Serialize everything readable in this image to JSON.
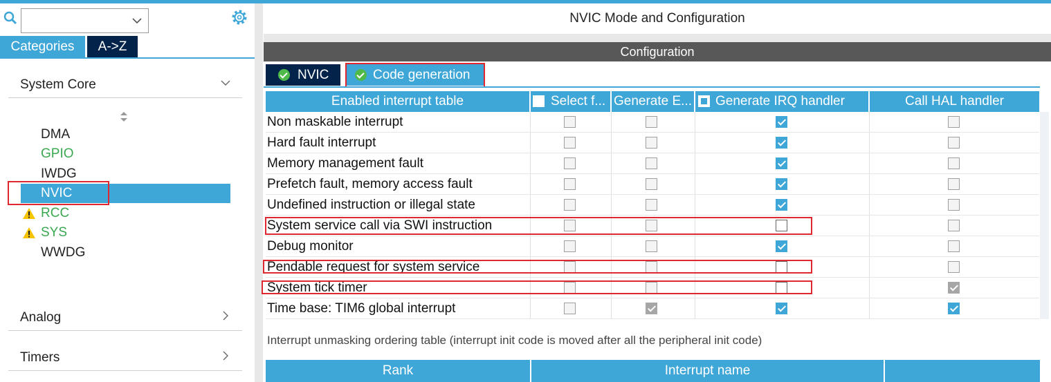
{
  "left": {
    "categories_tab": "Categories",
    "az_tab": "A->Z",
    "system_core": "System Core",
    "analog": "Analog",
    "timers": "Timers",
    "peripherals": [
      {
        "label": "DMA",
        "state": "normal"
      },
      {
        "label": "GPIO",
        "state": "green"
      },
      {
        "label": "IWDG",
        "state": "normal"
      },
      {
        "label": "NVIC",
        "state": "selected"
      },
      {
        "label": "RCC",
        "state": "warning"
      },
      {
        "label": "SYS",
        "state": "warning"
      },
      {
        "label": "WWDG",
        "state": "normal"
      }
    ]
  },
  "right": {
    "title": "NVIC Mode and Configuration",
    "config_bar": "Configuration",
    "tabs": [
      "NVIC",
      "Code generation"
    ],
    "headers": {
      "name": "Enabled interrupt table",
      "select": "Select f...",
      "generate_enable": "Generate E...",
      "generate_irq": "Generate IRQ handler",
      "call_hal": "Call HAL handler"
    },
    "rows": [
      {
        "name": "Non maskable interrupt",
        "select": "off",
        "gen_enable": "off",
        "gen_irq": "on",
        "call_hal": "off"
      },
      {
        "name": "Hard fault interrupt",
        "select": "off",
        "gen_enable": "off",
        "gen_irq": "on",
        "call_hal": "off"
      },
      {
        "name": "Memory management fault",
        "select": "off",
        "gen_enable": "off",
        "gen_irq": "on",
        "call_hal": "off"
      },
      {
        "name": "Prefetch fault, memory access fault",
        "select": "off",
        "gen_enable": "off",
        "gen_irq": "on",
        "call_hal": "off"
      },
      {
        "name": "Undefined instruction or illegal state",
        "select": "off",
        "gen_enable": "off",
        "gen_irq": "on",
        "call_hal": "off"
      },
      {
        "name": "System service call via SWI instruction",
        "select": "off",
        "gen_enable": "off",
        "gen_irq": "empty",
        "call_hal": "off"
      },
      {
        "name": "Debug monitor",
        "select": "off",
        "gen_enable": "off",
        "gen_irq": "on",
        "call_hal": "off"
      },
      {
        "name": "Pendable request for system service",
        "select": "off",
        "gen_enable": "off",
        "gen_irq": "empty",
        "call_hal": "off"
      },
      {
        "name": "System tick timer",
        "select": "off",
        "gen_enable": "off",
        "gen_irq": "empty",
        "call_hal": "disabled-on"
      },
      {
        "name": "Time base: TIM6 global interrupt",
        "select": "off",
        "gen_enable": "disabled-on",
        "gen_irq": "on",
        "call_hal": "on"
      }
    ],
    "note": "Interrupt unmasking ordering table (interrupt init code is moved after all the peripheral init code)",
    "rank_header": "Rank",
    "interrupt_name_header": "Interrupt name"
  },
  "colors": {
    "accent": "#3fa6d8",
    "dark_navy": "#03234b",
    "config_gray": "#585858",
    "highlight_red": "#e0262f",
    "ok_green": "#4fb94a"
  }
}
